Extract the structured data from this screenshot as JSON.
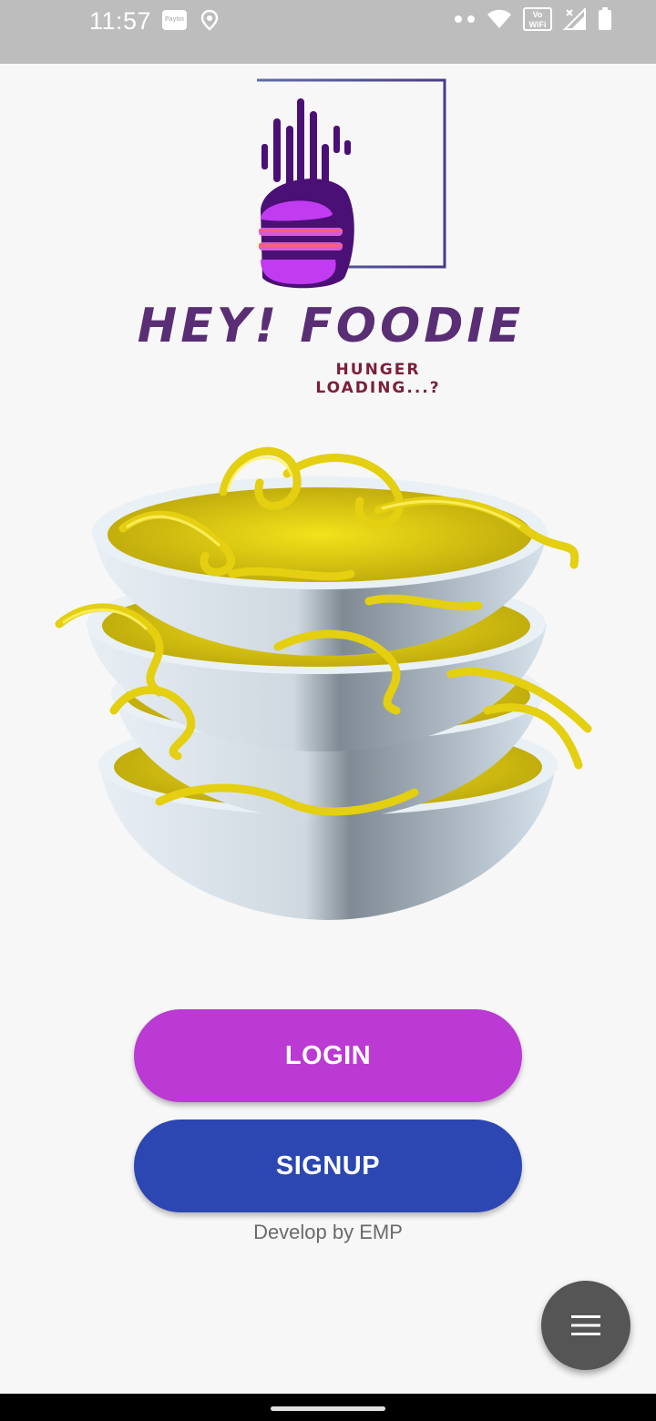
{
  "status_bar": {
    "time": "11:57",
    "icons_left": [
      "paytm-icon",
      "location-icon"
    ],
    "paytm_label": "Paytm",
    "icons_right": [
      "dots-icon",
      "wifi-icon",
      "vowifi-icon",
      "signal-icon",
      "battery-icon"
    ],
    "vowifi_label": "Vo WiFi"
  },
  "brand": {
    "name": "HEY! FOODIE",
    "tagline": "HUNGER LOADING...?",
    "logo_icon": "burger-logo-icon",
    "colors": {
      "purple": "#5a2e74",
      "tagline": "#7b1f3a",
      "logo_violet": "#6a0dad"
    }
  },
  "hero": {
    "image": "noodle-bowls-image"
  },
  "actions": {
    "login_label": "LOGIN",
    "signup_label": "SIGNUP",
    "login_color": "#bb3ad3",
    "signup_color": "#2c47b2"
  },
  "footer": {
    "credit": "Develop by EMP"
  },
  "fab": {
    "icon": "menu-icon"
  }
}
